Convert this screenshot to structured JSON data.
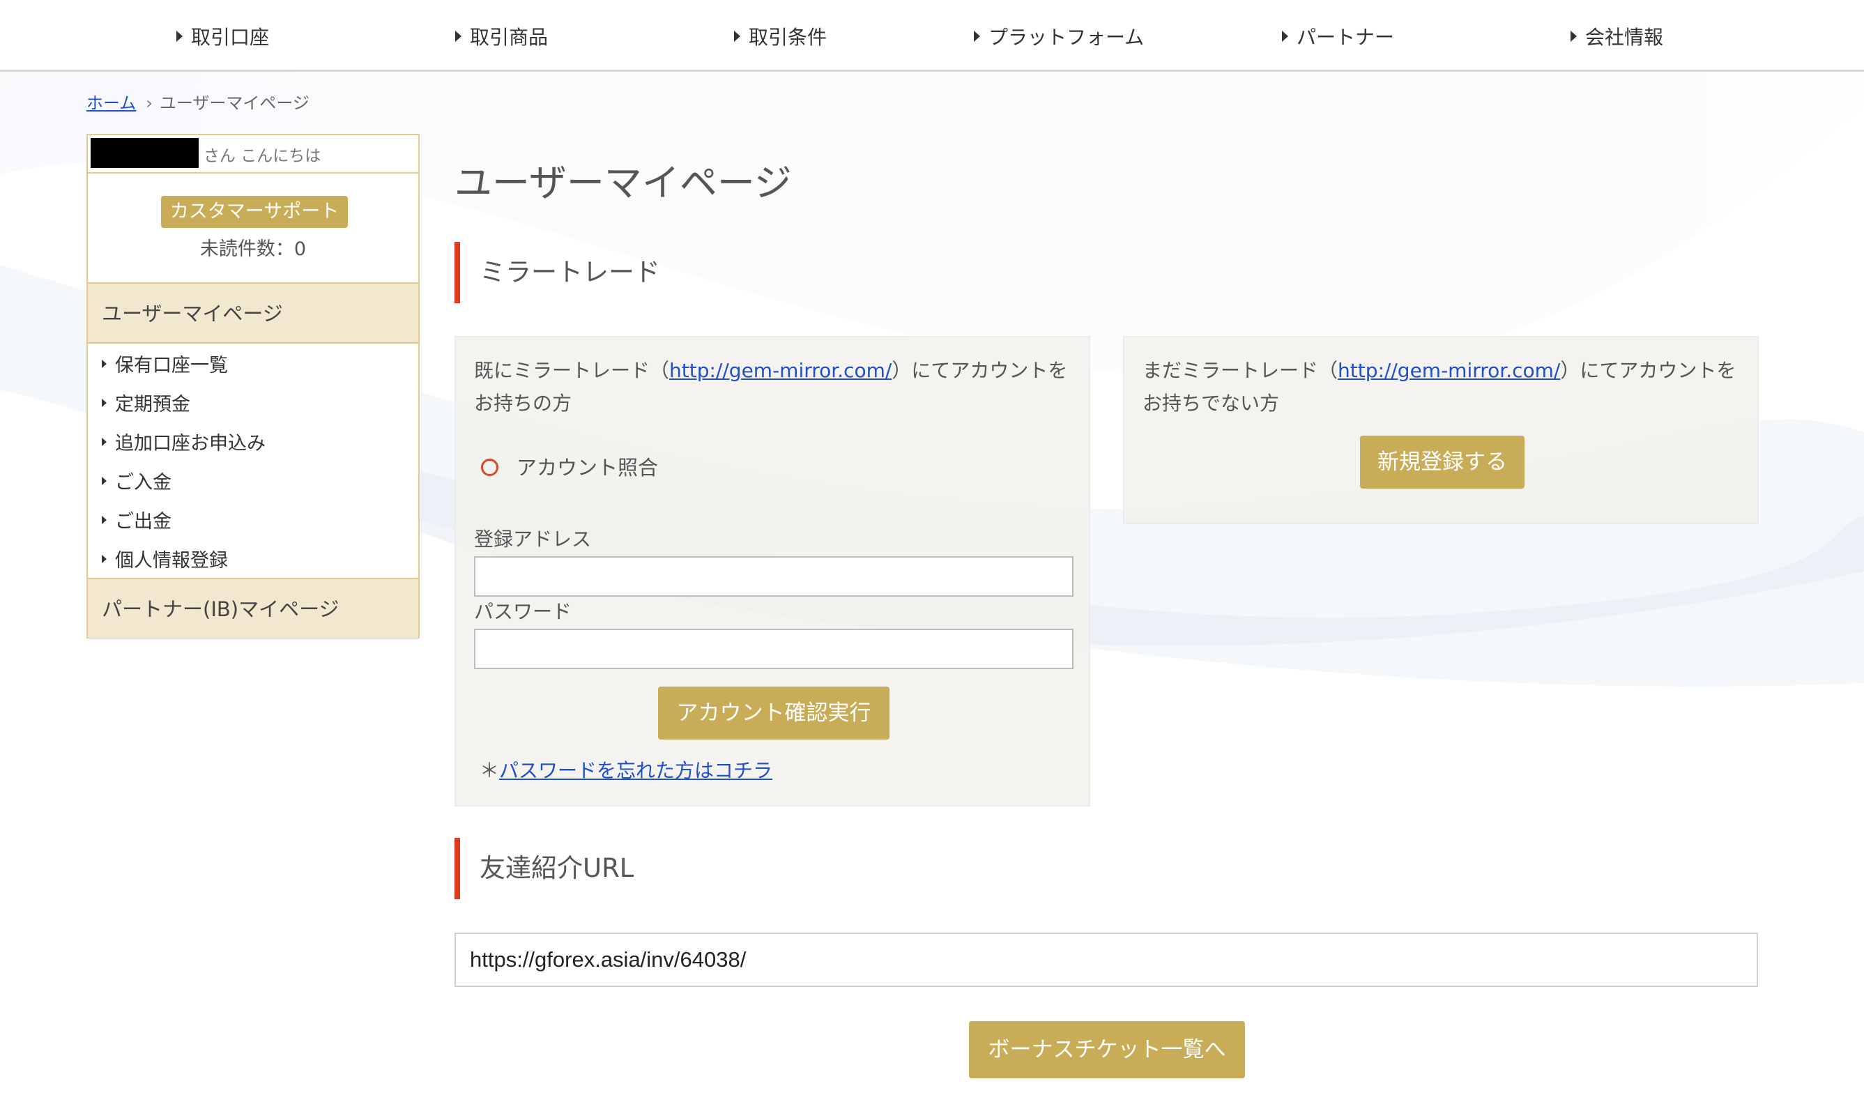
{
  "nav": [
    "取引口座",
    "取引商品",
    "取引条件",
    "プラットフォーム",
    "パートナー",
    "会社情報"
  ],
  "breadcrumb": {
    "home": "ホーム",
    "current": "ユーザーマイページ"
  },
  "sidebar": {
    "greeting": "さん こんにちは",
    "support_button": "カスタマーサポート",
    "unread": "未読件数：0",
    "user_section": "ユーザーマイページ",
    "menu": [
      "保有口座一覧",
      "定期預金",
      "追加口座お申込み",
      "ご入金",
      "ご出金",
      "個人情報登録"
    ],
    "partner_section": "パートナー(IB)マイページ"
  },
  "main": {
    "title": "ユーザーマイページ",
    "mirror": {
      "heading": "ミラートレード",
      "existing": {
        "text_before": "既にミラートレード（",
        "link": "http://gem-mirror.com/",
        "text_after": "）にてアカウントをお持ちの方",
        "radio_label": "アカウント照合",
        "address_label": "登録アドレス",
        "address_value": "",
        "password_label": "パスワード",
        "password_value": "",
        "submit": "アカウント確認実行",
        "forgot_prefix": "＊",
        "forgot_link": "パスワードを忘れた方はコチラ"
      },
      "new": {
        "text_before": "まだミラートレード（",
        "link": "http://gem-mirror.com/",
        "text_after": "）にてアカウントをお持ちでない方",
        "button": "新規登録する"
      }
    },
    "referral": {
      "heading": "友達紹介URL",
      "url": "https://gforex.asia/inv/64038/"
    },
    "bonus_button": "ボーナスチケット一覧へ"
  },
  "colors": {
    "accent_gold": "#c9ac57",
    "heading_bar": "#e03a1e",
    "sidebar_border": "#e8c88f",
    "link": "#1f4fc9"
  }
}
